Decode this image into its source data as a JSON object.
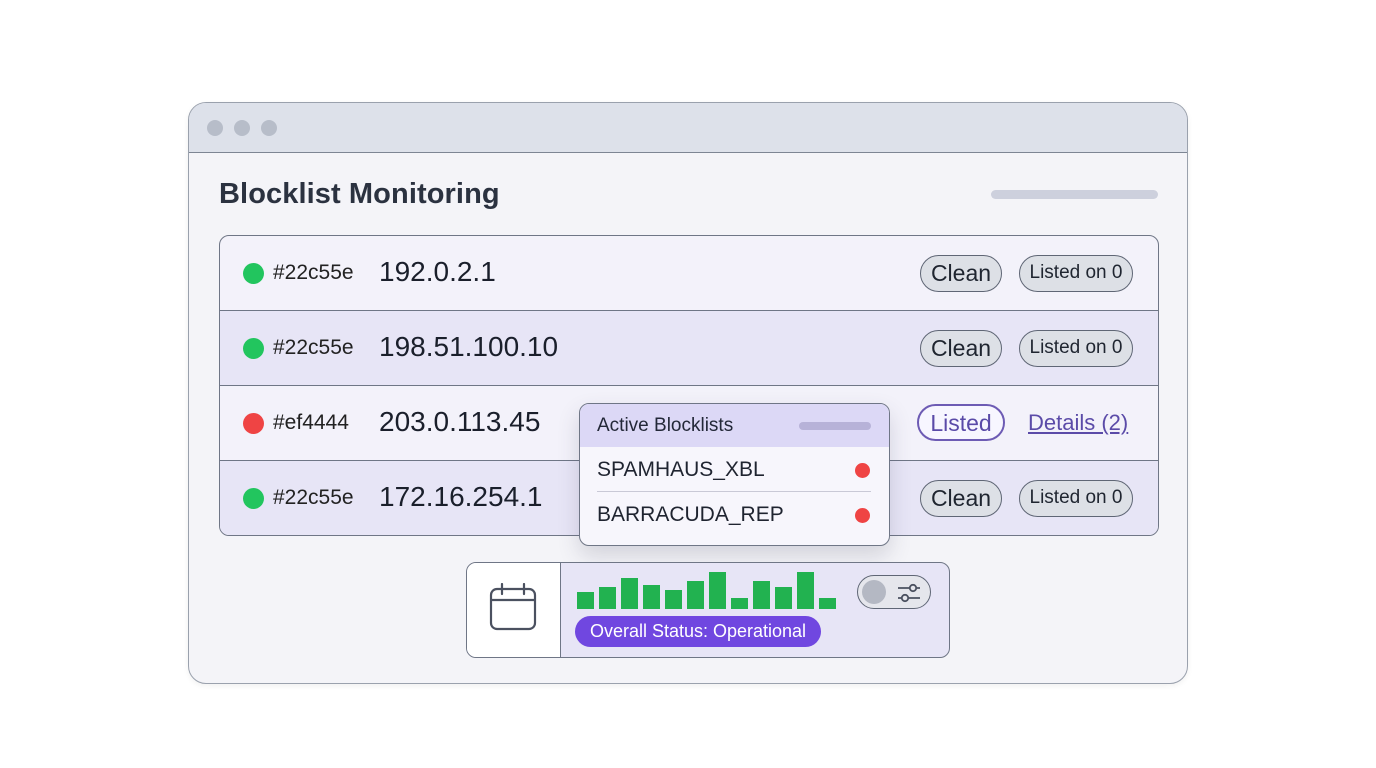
{
  "page": {
    "title": "Blocklist Monitoring"
  },
  "rows": [
    {
      "color": "#22c55e",
      "color_label": "#22c55e",
      "ip": "192.0.2.1",
      "status": "Clean",
      "listed_count": "Listed on 0"
    },
    {
      "color": "#22c55e",
      "color_label": "#22c55e",
      "ip": "198.51.100.10",
      "status": "Clean",
      "listed_count": "Listed on 0"
    },
    {
      "color": "#ef4444",
      "color_label": "#ef4444",
      "ip": "203.0.113.45",
      "status": "Listed",
      "details_link": "Details (2)"
    },
    {
      "color": "#22c55e",
      "color_label": "#22c55e",
      "ip": "172.16.254.1",
      "status": "Clean",
      "listed_count": "Listed on 0"
    }
  ],
  "popover": {
    "title": "Active Blocklists",
    "items": [
      {
        "name": "SPAMHAUS_XBL",
        "status_color": "#ef4444"
      },
      {
        "name": "BARRACUDA_REP",
        "status_color": "#ef4444"
      }
    ]
  },
  "footer": {
    "calendar_icon": "calendar-icon",
    "activity_levels": [
      0.45,
      0.6,
      0.85,
      0.65,
      0.5,
      0.75,
      1.0,
      0.3,
      0.75,
      0.6,
      1.0,
      0.3
    ],
    "bar_color": "#22b250",
    "toggle_icon": "sliders-icon",
    "overall_status": "Overall Status: Operational",
    "overall_status_color": "#7047e0"
  }
}
